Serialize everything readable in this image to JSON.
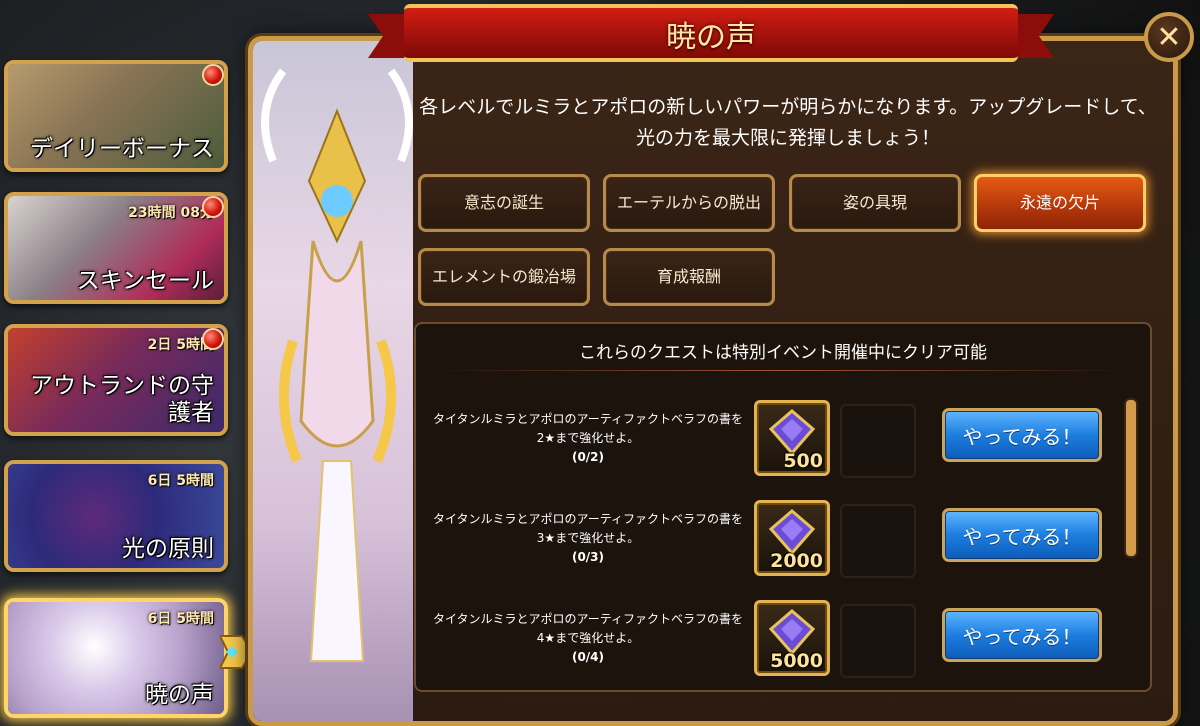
{
  "sidebar": {
    "cards": [
      {
        "label": "デイリーボーナス",
        "timer": "",
        "has_dot": true
      },
      {
        "label": "スキンセール",
        "timer": "23時間 08分",
        "has_dot": true
      },
      {
        "label": "アウトランドの守\n護者",
        "timer": "2日 5時間",
        "has_dot": true
      },
      {
        "label": "光の原則",
        "timer": "6日 5時間",
        "has_dot": false
      },
      {
        "label": "暁の声",
        "timer": "6日 5時間",
        "has_dot": false,
        "active": true
      }
    ]
  },
  "banner": {
    "title": "暁の声"
  },
  "description": "各レベルでルミラとアポロの新しいパワーが明らかになります。アップグレードして、光の力を最大限に発揮しましょう！",
  "tabs": [
    {
      "label": "意志の誕生",
      "active": false
    },
    {
      "label": "エーテルからの脱出",
      "active": false
    },
    {
      "label": "姿の具現",
      "active": false
    },
    {
      "label": "永遠の欠片",
      "active": true
    },
    {
      "label": "エレメントの鍛冶場",
      "active": false
    },
    {
      "label": "育成報酬",
      "active": false
    }
  ],
  "quests": {
    "header": "これらのクエストは特別イベント開催中にクリア可能",
    "items": [
      {
        "text": "タイタンルミラとアポロのアーティファクトベラフの書を2★まで強化せよ。",
        "progress": "(0/2)",
        "reward_amount": "500",
        "button": "やってみる！"
      },
      {
        "text": "タイタンルミラとアポロのアーティファクトベラフの書を3★まで強化せよ。",
        "progress": "(0/3)",
        "reward_amount": "2000",
        "button": "やってみる！"
      },
      {
        "text": "タイタンルミラとアポロのアーティファクトベラフの書を4★まで強化せよ。",
        "progress": "(0/4)",
        "reward_amount": "5000",
        "button": "やってみる！"
      }
    ]
  },
  "colors": {
    "active_tab": "#d9480f",
    "button_blue": "#1c7ee0",
    "banner_red": "#c0160f",
    "gold_border": "#c89a4a"
  },
  "icons": {
    "close": "close-icon",
    "reward": "gem-icon"
  }
}
